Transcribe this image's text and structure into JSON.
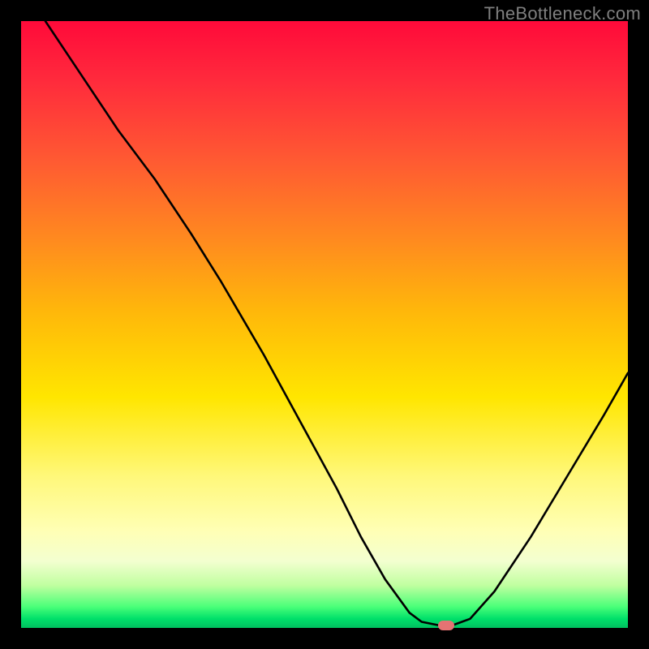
{
  "watermark": "TheBottleneck.com",
  "chart_data": {
    "type": "line",
    "title": "",
    "xlabel": "",
    "ylabel": "",
    "xlim": [
      0,
      100
    ],
    "ylim": [
      0,
      100
    ],
    "grid": false,
    "legend": false,
    "series": [
      {
        "name": "curve",
        "x": [
          4,
          10,
          16,
          22,
          28,
          33,
          40,
          46,
          52,
          56,
          60,
          64,
          66,
          69,
          71,
          74,
          78,
          84,
          90,
          96,
          100
        ],
        "values": [
          100,
          91,
          82,
          74,
          65,
          57,
          45,
          34,
          23,
          15,
          8,
          2.5,
          1,
          0.4,
          0.4,
          1.5,
          6,
          15,
          25,
          35,
          42
        ]
      }
    ],
    "marker": {
      "x": 70,
      "y": 0.4,
      "color": "#e57373"
    },
    "gradient_stops": [
      {
        "pct": 0,
        "color": "#ff0a3a"
      },
      {
        "pct": 10,
        "color": "#ff2b3c"
      },
      {
        "pct": 23,
        "color": "#ff5a32"
      },
      {
        "pct": 36,
        "color": "#ff8a1f"
      },
      {
        "pct": 48,
        "color": "#ffb80a"
      },
      {
        "pct": 62,
        "color": "#ffe600"
      },
      {
        "pct": 75,
        "color": "#fff87a"
      },
      {
        "pct": 84,
        "color": "#ffffb5"
      },
      {
        "pct": 89,
        "color": "#f3ffd0"
      },
      {
        "pct": 93,
        "color": "#c0ffa0"
      },
      {
        "pct": 96.5,
        "color": "#4bff79"
      },
      {
        "pct": 98.5,
        "color": "#00e06a"
      },
      {
        "pct": 100,
        "color": "#00c060"
      }
    ]
  }
}
